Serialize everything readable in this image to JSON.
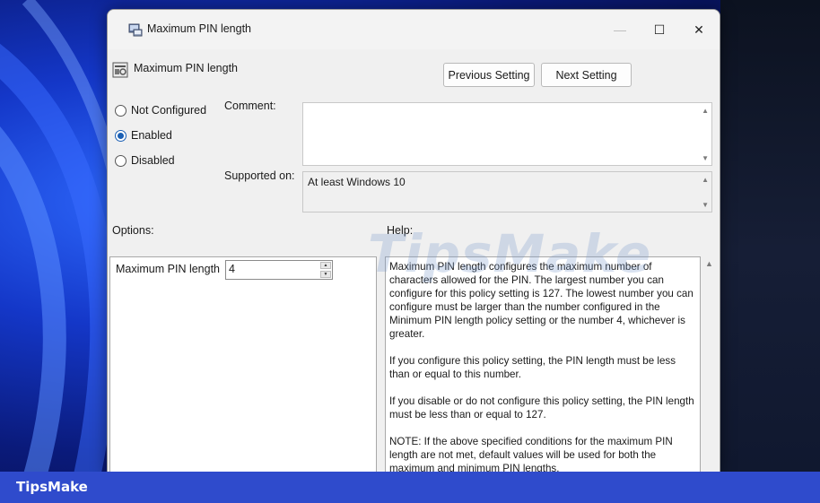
{
  "window": {
    "title": "Maximum PIN length",
    "controls": {
      "minimize": "—",
      "maximize": "☐",
      "close": "✕"
    }
  },
  "header": {
    "policy_title": "Maximum PIN length",
    "prev_button": "Previous Setting",
    "next_button": "Next Setting"
  },
  "state": {
    "options": [
      {
        "label": "Not Configured",
        "checked": false
      },
      {
        "label": "Enabled",
        "checked": true
      },
      {
        "label": "Disabled",
        "checked": false
      }
    ]
  },
  "comment": {
    "label": "Comment:",
    "value": ""
  },
  "supported": {
    "label": "Supported on:",
    "value": "At least Windows 10"
  },
  "options_pane": {
    "heading": "Options:",
    "field_label": "Maximum PIN length",
    "field_value": "4"
  },
  "help_pane": {
    "heading": "Help:",
    "paragraphs": [
      "Maximum PIN length configures the maximum number of characters allowed for the PIN.  The largest number you can configure for this policy setting is 127. The lowest number you can configure must be larger than the number configured in the Minimum PIN length policy setting or the number 4, whichever is greater.",
      "If you configure this policy setting, the PIN length must be less than or equal to this number.",
      "If you disable or do not configure this policy setting, the PIN length must be less than or equal to 127.",
      "NOTE: If the above specified conditions for the maximum PIN length are not met, default values will be used for both the maximum and minimum PIN lengths."
    ]
  },
  "watermark": "TipsMake",
  "brand": "TipsMake",
  "icons": {
    "title": "group-policy-icon",
    "policy": "policy-setting-icon",
    "scroll_up": "▲",
    "scroll_down": "▼"
  }
}
